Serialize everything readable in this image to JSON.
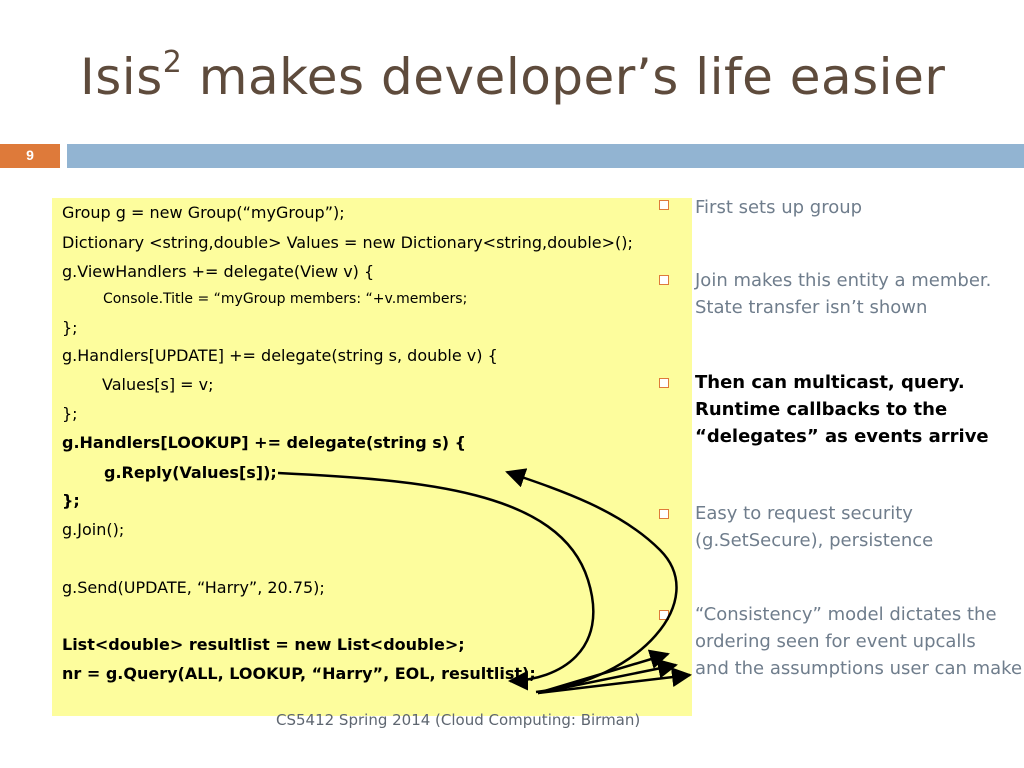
{
  "slide": {
    "title_main": "Isis",
    "title_sup": "2",
    "title_rest": " makes developer’s life easier",
    "page_number": "9",
    "footer": "CS5412 Spring 2014 (Cloud Computing: Birman)"
  },
  "code": [
    "Group g = new Group(“myGroup”);",
    "Dictionary <string,double> Values = new Dictionary<string,double>();",
    "g.ViewHandlers += delegate(View v) {",
    "Console.Title = “myGroup members: “+v.members;",
    "};",
    "g.Handlers[UPDATE] += delegate(string s, double v) {",
    "Values[s] = v;",
    "};",
    "g.Handlers[LOOKUP] += delegate(string s) {",
    "g.Reply(Values[s]);",
    "};",
    "g.Join();",
    "g.Send(UPDATE, “Harry”, 20.75);",
    "List<double> resultlist = new List<double>;",
    "nr = g.Query(ALL, LOOKUP, “Harry”, EOL, resultlist);"
  ],
  "bullets": [
    [
      "First sets up group"
    ],
    [
      "Join makes this entity a member.",
      "State transfer isn’t shown"
    ],
    [
      "Then can multicast, query.",
      "Runtime callbacks to the",
      "“delegates” as events arrive"
    ],
    [
      "Easy to request security",
      "(g.SetSecure), persistence"
    ],
    [
      "“Consistency” model dictates the",
      "ordering seen for event upcalls",
      "and the assumptions user can make"
    ]
  ]
}
